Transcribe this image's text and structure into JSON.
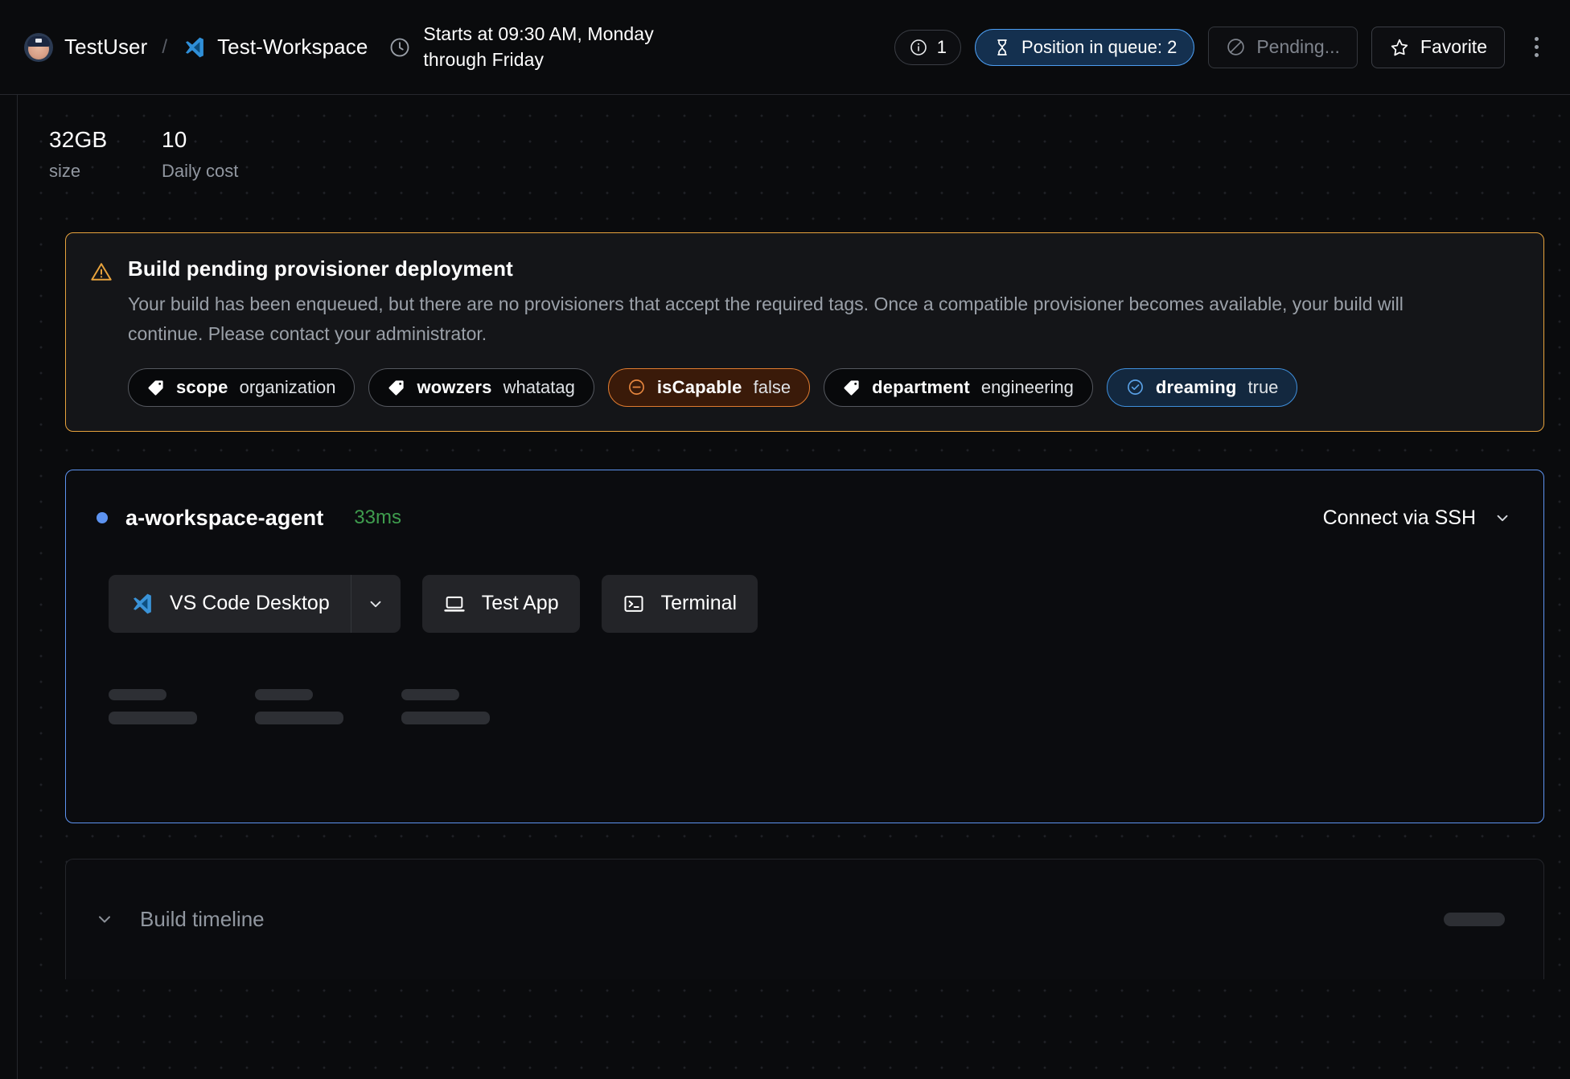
{
  "topbar": {
    "user": "TestUser",
    "separator": "/",
    "workspace": "Test-Workspace",
    "workspace_icon": "vscode-icon",
    "avatar_icon": "user-avatar",
    "clock_icon": "clock-icon",
    "schedule": "Starts at 09:30 AM, Monday through Friday",
    "info_chip": {
      "icon": "info-circle-icon",
      "label": "1"
    },
    "queue_chip": {
      "icon": "hourglass-icon",
      "label": "Position in queue: 2"
    },
    "pending_button": {
      "icon": "ban-circle-icon",
      "label": "Pending..."
    },
    "favorite_button": {
      "icon": "star-icon",
      "label": "Favorite"
    },
    "more_button": {
      "icon": "kebab-menu-icon"
    }
  },
  "stats": [
    {
      "value": "32GB",
      "label": "size"
    },
    {
      "value": "10",
      "label": "Daily cost"
    }
  ],
  "alert": {
    "icon": "warning-triangle-icon",
    "title": "Build pending provisioner deployment",
    "description": "Your build has been enqueued, but there are no provisioners that accept the required tags. Once a compatible provisioner becomes available, your build will continue. Please contact your administrator.",
    "tags": [
      {
        "icon": "tag-icon",
        "key": "scope",
        "value": "organization",
        "style": "default"
      },
      {
        "icon": "tag-icon",
        "key": "wowzers",
        "value": "whatatag",
        "style": "default"
      },
      {
        "icon": "minus-circle-icon",
        "key": "isCapable",
        "value": "false",
        "style": "danger"
      },
      {
        "icon": "tag-icon",
        "key": "department",
        "value": "engineering",
        "style": "default"
      },
      {
        "icon": "check-circle-icon",
        "key": "dreaming",
        "value": "true",
        "style": "info"
      }
    ]
  },
  "agent": {
    "status_icon": "status-dot-icon",
    "name": "a-workspace-agent",
    "latency": "33ms",
    "ssh_label": "Connect via SSH",
    "ssh_chevron_icon": "chevron-down-icon",
    "apps": [
      {
        "icon": "vscode-icon",
        "label": "VS Code Desktop",
        "has_dropdown": true,
        "dropdown_icon": "chevron-down-icon"
      },
      {
        "icon": "laptop-icon",
        "label": "Test App",
        "has_dropdown": false
      },
      {
        "icon": "terminal-icon",
        "label": "Terminal",
        "has_dropdown": false
      }
    ]
  },
  "timeline": {
    "chevron_icon": "chevron-down-icon",
    "label": "Build timeline"
  },
  "colors": {
    "background": "#0a0b0d",
    "alert_border": "#e8a33d",
    "agent_border": "#5d93f0",
    "accent_blue": "#4c9df0",
    "latency_green": "#3f9d4e",
    "danger_orange": "#e07b2f",
    "muted_text": "#9197a0"
  }
}
